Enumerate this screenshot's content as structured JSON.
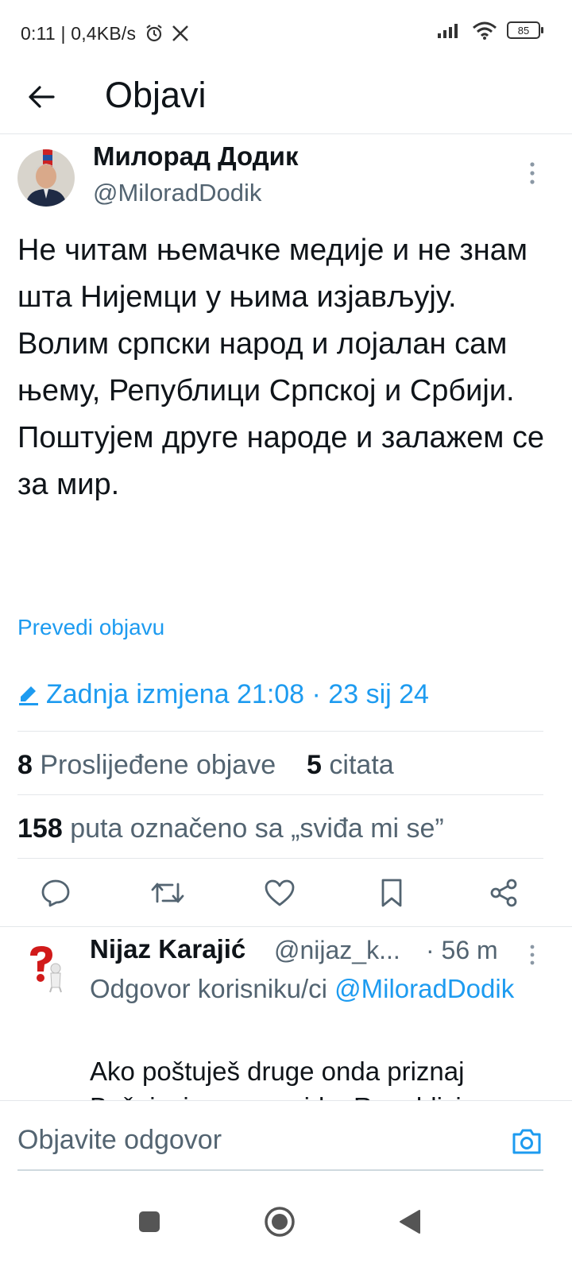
{
  "status_bar": {
    "time_speed": "0:11 | 0,4KB/s",
    "battery": "85",
    "icons": [
      "alarm-icon",
      "x-logo-icon",
      "signal-icon",
      "wifi-icon",
      "battery-icon"
    ]
  },
  "header": {
    "title": "Objavi",
    "back_icon": "arrow-left-icon"
  },
  "tweet": {
    "author_name": "Милорад Додик",
    "author_handle": "@MiloradDodik",
    "text_paragraphs": [
      "Не читам њемачке медије и не знам шта Нијемци у њима изјављују.",
      "Волим српски народ и лојалан сам њему, Републици Српској и Србији.",
      "Поштујем друге народе и залажем се за мир."
    ],
    "translate_label": "Prevedi objavu",
    "edited_label": "Zadnja izmjena 21:08 · 23 sij 24",
    "retweets_count": "8",
    "retweets_label": "Proslijeđene objave",
    "quotes_count": "5",
    "quotes_label": "citata",
    "likes_count": "158",
    "likes_label": "puta označeno sa „sviđa mi se”"
  },
  "actions": [
    "reply-icon",
    "retweet-icon",
    "like-icon",
    "bookmark-icon",
    "share-icon"
  ],
  "reply": {
    "author_name": "Nijaz Karajić",
    "author_handle": "@nijaz_k...",
    "time": "· 56 m",
    "context_prefix": "Odgovor korisniku/ci",
    "context_mention": "@MiloradDodik",
    "text_line1": "Ako poštuješ druge onda priznaj",
    "text_line2": "Bošnjacima genocid u Republici"
  },
  "composer": {
    "placeholder": "Objavite odgovor"
  },
  "colors": {
    "accent": "#1d9bf0",
    "text": "#0f1419",
    "secondary": "#536471",
    "divider": "#e4e7ea"
  }
}
